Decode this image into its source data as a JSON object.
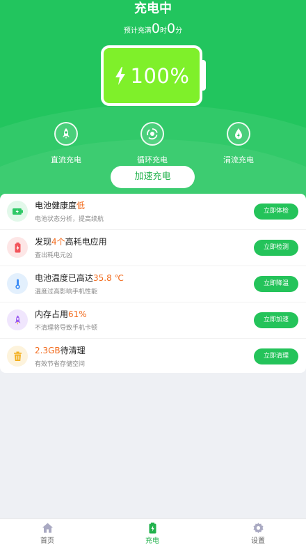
{
  "header": {
    "title": "充电中",
    "eta_prefix": "预计充满",
    "eta_hours": "0",
    "eta_hours_unit": "时",
    "eta_minutes": "0",
    "eta_minutes_unit": "分"
  },
  "battery": {
    "percent_label": "100%",
    "level": 1.0
  },
  "modes": [
    {
      "label": "直流充电",
      "icon": "rocket-icon"
    },
    {
      "label": "循环充电",
      "icon": "cycle-icon"
    },
    {
      "label": "涓流充电",
      "icon": "drop-bolt-icon"
    }
  ],
  "boost_button": "加速充电",
  "items": [
    {
      "icon": "battery-health-icon",
      "pre": "电池健康度",
      "hl": "低",
      "post": "",
      "sub": "电池状态分析，提高续航",
      "button": "立即体检",
      "icon_bg": "#e2f8ea"
    },
    {
      "icon": "battery-drain-icon",
      "pre": "发现",
      "hl": "4个",
      "post": "高耗电应用",
      "sub": "查出耗电元凶",
      "button": "立即检测",
      "icon_bg": "#fde6e6"
    },
    {
      "icon": "thermometer-icon",
      "pre": "电池温度已高达",
      "hl": "35.8 ℃",
      "post": "",
      "sub": "温度过高影响手机性能",
      "button": "立即降温",
      "icon_bg": "#e3f0fd"
    },
    {
      "icon": "rocket-memory-icon",
      "pre": "内存占用",
      "hl": "61%",
      "post": "",
      "sub": "不清理将导致手机卡顿",
      "button": "立即加速",
      "icon_bg": "#f0e6fd"
    },
    {
      "icon": "trash-icon",
      "pre": "",
      "hl": "2.3GB",
      "post": "待清理",
      "sub": "有效节省存储空间",
      "button": "立即清理",
      "icon_bg": "#fdf3dc"
    }
  ],
  "tabs": [
    {
      "label": "首页",
      "icon": "home-icon"
    },
    {
      "label": "充电",
      "icon": "charge-icon"
    },
    {
      "label": "设置",
      "icon": "settings-gear-icon"
    }
  ],
  "colors": {
    "primary": "#22c55e",
    "battery_fill": "#7ff02a",
    "highlight": "#f26b1d",
    "button": "#24c35a"
  }
}
